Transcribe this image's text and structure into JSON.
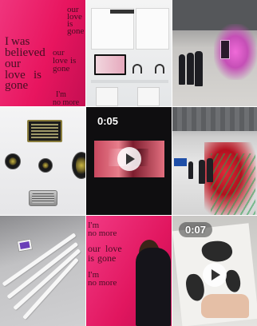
{
  "grid": {
    "items": [
      {
        "type": "photo",
        "wall_text": [
          "our",
          "love",
          "is",
          "gone",
          "I",
          "was",
          "believed",
          "our",
          "love",
          "is",
          "gone",
          "our",
          "love",
          "is",
          "gone",
          "I'm",
          "no more"
        ]
      },
      {
        "type": "photo"
      },
      {
        "type": "photo"
      },
      {
        "type": "photo"
      },
      {
        "type": "video",
        "duration": "0:05"
      },
      {
        "type": "photo"
      },
      {
        "type": "photo"
      },
      {
        "type": "photo",
        "wall_text": [
          "I'm",
          "no more",
          "our",
          "love",
          "is",
          "gone",
          "I'm",
          "no more"
        ]
      },
      {
        "type": "video",
        "duration": "0:07"
      }
    ]
  },
  "colors": {
    "pink": "#ea1d6b",
    "dark": "#0f0e10"
  },
  "icons": {
    "play": "play-icon"
  }
}
